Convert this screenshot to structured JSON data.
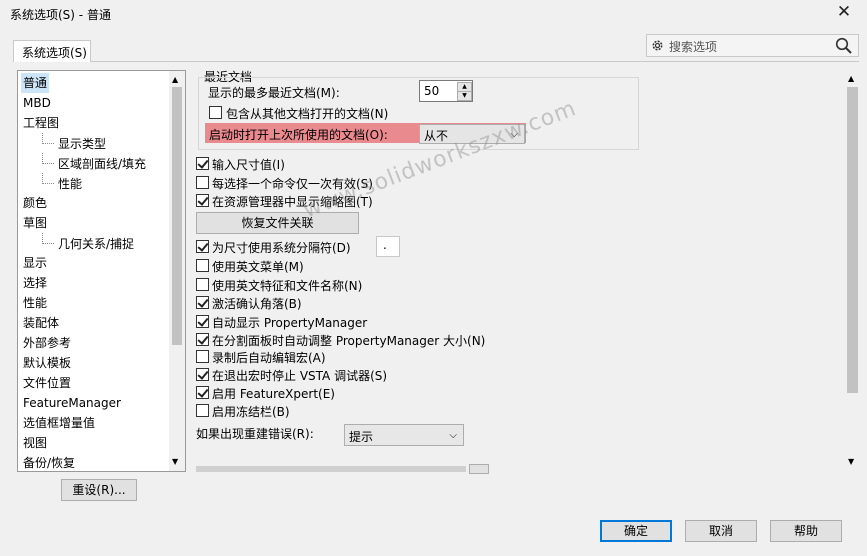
{
  "window": {
    "title": "系统选项(S) - 普通",
    "close_glyph": "✕"
  },
  "tabs": [
    {
      "label": "系统选项(S)"
    }
  ],
  "search": {
    "placeholder": "搜索选项"
  },
  "tree": {
    "items": [
      {
        "label": "普通",
        "level": 0,
        "selected": true
      },
      {
        "label": "MBD",
        "level": 0
      },
      {
        "label": "工程图",
        "level": 0
      },
      {
        "label": "显示类型",
        "level": 1
      },
      {
        "label": "区域剖面线/填充",
        "level": 1
      },
      {
        "label": "性能",
        "level": 1
      },
      {
        "label": "颜色",
        "level": 0
      },
      {
        "label": "草图",
        "level": 0
      },
      {
        "label": "几何关系/捕捉",
        "level": 1
      },
      {
        "label": "显示",
        "level": 0
      },
      {
        "label": "选择",
        "level": 0
      },
      {
        "label": "性能",
        "level": 0
      },
      {
        "label": "装配体",
        "level": 0
      },
      {
        "label": "外部参考",
        "level": 0
      },
      {
        "label": "默认模板",
        "level": 0
      },
      {
        "label": "文件位置",
        "level": 0
      },
      {
        "label": "FeatureManager",
        "level": 0
      },
      {
        "label": "选值框增量值",
        "level": 0
      },
      {
        "label": "视图",
        "level": 0
      },
      {
        "label": "备份/恢复",
        "level": 0
      }
    ]
  },
  "reset_button": "重设(R)...",
  "recent_docs": {
    "heading": "最近文档",
    "max_label": "显示的最多最近文档(M):",
    "max_value": "50",
    "include_other_label": "包含从其他文档打开的文档(N)",
    "include_other_checked": false,
    "open_last_label": "启动时打开上次所使用的文档(O):",
    "open_last_value": "从不"
  },
  "options": [
    {
      "label": "输入尺寸值(I)",
      "checked": true
    },
    {
      "label": "每选择一个命令仅一次有效(S)",
      "checked": false
    },
    {
      "label": "在资源管理器中显示缩略图(T)",
      "checked": true
    }
  ],
  "restore_assoc_button": "恢复文件关联",
  "options2": [
    {
      "label": "为尺寸使用系统分隔符(D)",
      "checked": true
    },
    {
      "label": "使用英文菜单(M)",
      "checked": false
    },
    {
      "label": "使用英文特征和文件名称(N)",
      "checked": false
    },
    {
      "label": "激活确认角落(B)",
      "checked": true
    },
    {
      "label": "自动显示 PropertyManager",
      "checked": true
    },
    {
      "label": "在分割面板时自动调整 PropertyManager 大小(N)",
      "checked": true
    },
    {
      "label": "录制后自动编辑宏(A)",
      "checked": false
    },
    {
      "label": "在退出宏时停止 VSTA 调试器(S)",
      "checked": true
    },
    {
      "label": "启用 FeatureXpert(E)",
      "checked": true
    },
    {
      "label": "启用冻结栏(B)",
      "checked": false
    }
  ],
  "separator_value": ".",
  "rebuild_error": {
    "label": "如果出现重建错误(R):",
    "value": "提示"
  },
  "watermark": "www.solidworkszxw.com",
  "footer": {
    "ok": "确定",
    "cancel": "取消",
    "help": "帮助"
  },
  "colors": {
    "highlight": "#e98a8f",
    "primary_border": "#0078d7"
  }
}
